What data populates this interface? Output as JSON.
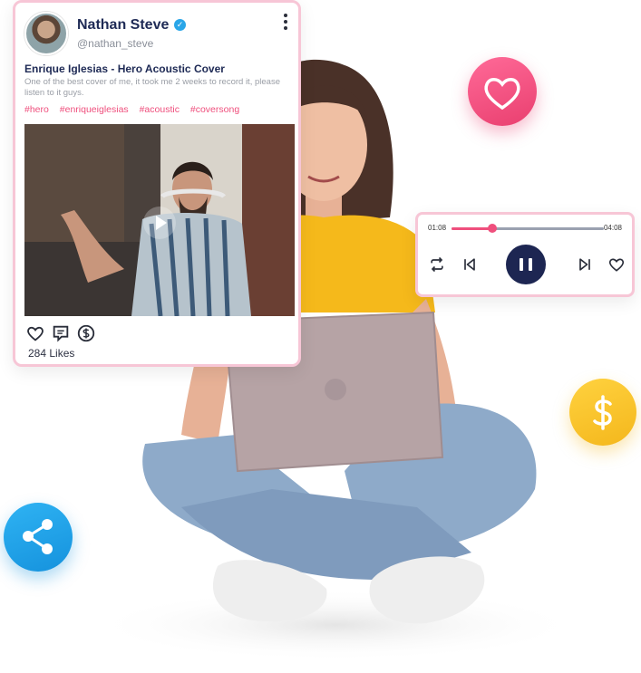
{
  "post": {
    "author_name": "Nathan Steve",
    "author_handle": "@nathan_steve",
    "title": "Enrique Iglesias - Hero Acoustic Cover",
    "description": "One of the best cover of me, it took me 2 weeks to record it, please listen to it guys.",
    "tags": [
      "#hero",
      "#enriqueiglesias",
      "#acoustic",
      "#coversong"
    ],
    "likes": "284 Likes"
  },
  "player": {
    "elapsed": "01:08",
    "total": "04:08",
    "progress": 0.27
  },
  "colors": {
    "accent_pink": "#ef4f7d",
    "navy": "#1d2652",
    "share_blue": "#1592dd",
    "gold": "#f4b71c"
  },
  "icons": {
    "post_actions": [
      "heart-icon",
      "comment-icon",
      "dollar-icon"
    ],
    "player_controls": [
      "repeat-icon",
      "previous-icon",
      "pause-icon",
      "next-icon",
      "heart-icon"
    ],
    "floating": [
      "heart-icon",
      "dollar-icon",
      "share-icon"
    ]
  }
}
